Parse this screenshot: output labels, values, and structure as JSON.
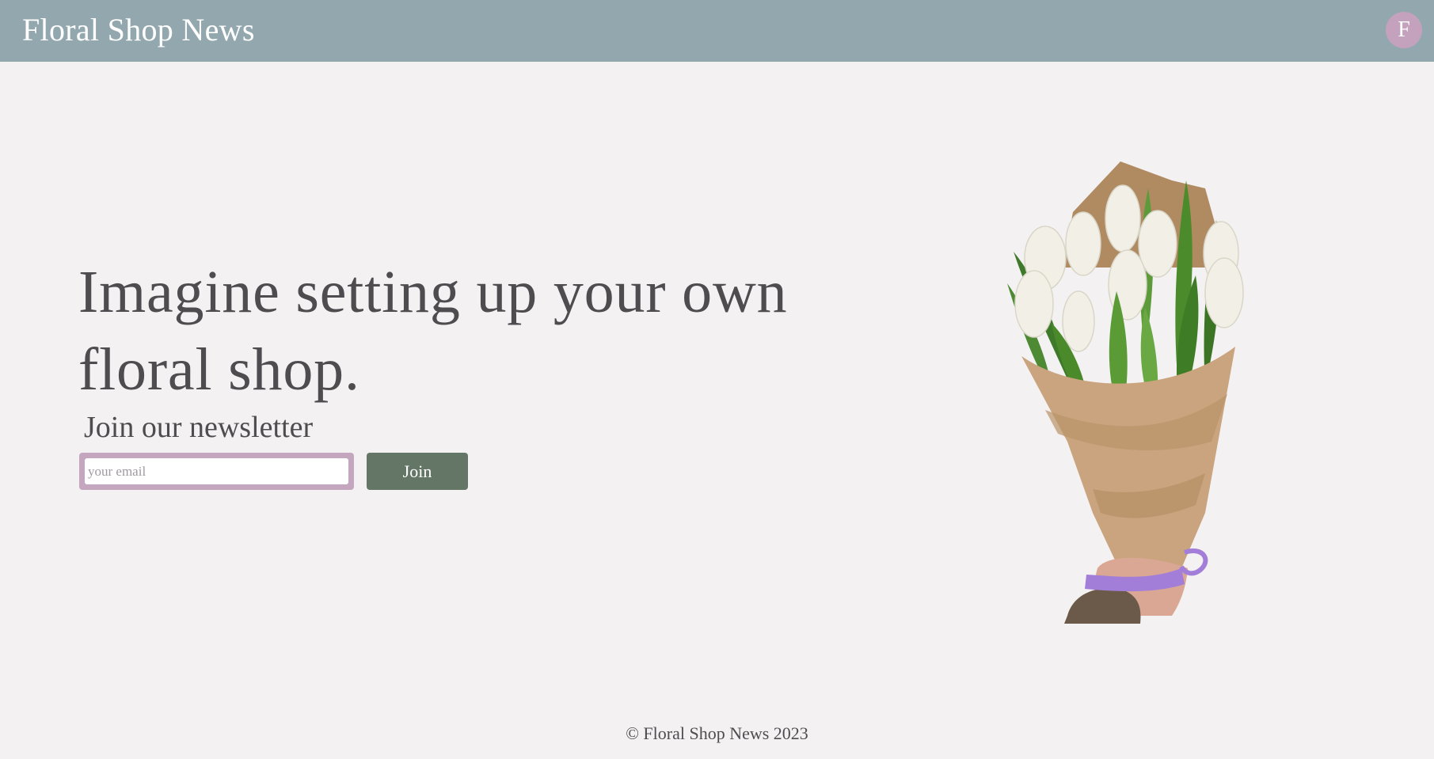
{
  "header": {
    "title": "Floral Shop News",
    "avatar_letter": "F"
  },
  "hero": {
    "headline": "Imagine setting up your own floral shop.",
    "newsletter_title": "Join our newsletter",
    "email_placeholder": "your email",
    "email_value": "",
    "join_label": "Join"
  },
  "illustration": {
    "icon": "tulip-bouquet-image"
  },
  "footer": {
    "copyright": "© Floral Shop News 2023"
  },
  "colors": {
    "header_bg": "#93a8ae",
    "page_bg": "#f4f1f2",
    "avatar_bg": "#c4a2bd",
    "input_border": "#c4a7bf",
    "button_bg": "#647767",
    "text": "#4f4c50"
  }
}
